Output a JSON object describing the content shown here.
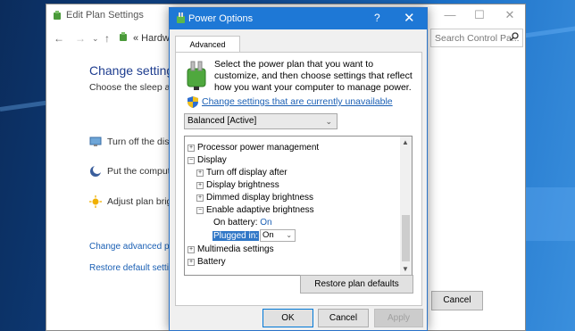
{
  "back_window": {
    "title": "Edit Plan Settings",
    "breadcrumb": "« Hardwa",
    "search_placeholder": "Search Control Pa...",
    "heading": "Change settings",
    "subheading": "Choose the sleep and",
    "rows": [
      {
        "label": "Turn off the displa",
        "icon": "monitor-icon"
      },
      {
        "label": "Put the computer",
        "icon": "moon-icon"
      },
      {
        "label": "Adjust plan bright",
        "icon": "sun-icon"
      }
    ],
    "link_advanced": "Change advanced pov",
    "link_restore": "Restore default setting",
    "cancel_label": "Cancel"
  },
  "dialog": {
    "title": "Power Options",
    "help": "?",
    "close": "✕",
    "tab": "Advanced settings",
    "intro": "Select the power plan that you want to customize, and then choose settings that reflect how you want your computer to manage power.",
    "change_link": "Change settings that are currently unavailable",
    "plan": "Balanced [Active]",
    "tree": {
      "processor": "Processor power management",
      "display": "Display",
      "turn_off": "Turn off display after",
      "brightness": "Display brightness",
      "dimmed": "Dimmed display brightness",
      "adaptive": "Enable adaptive brightness",
      "on_battery_label": "On battery:",
      "on_battery_value": "On",
      "plugged_in_label": "Plugged in:",
      "plugged_in_value": "On",
      "multimedia": "Multimedia settings",
      "battery": "Battery"
    },
    "restore_button": "Restore plan defaults",
    "ok": "OK",
    "cancel": "Cancel",
    "apply": "Apply"
  },
  "colors": {
    "titlebar": "#1e78d6",
    "link": "#1a5fb4",
    "selection": "#3077c7"
  }
}
